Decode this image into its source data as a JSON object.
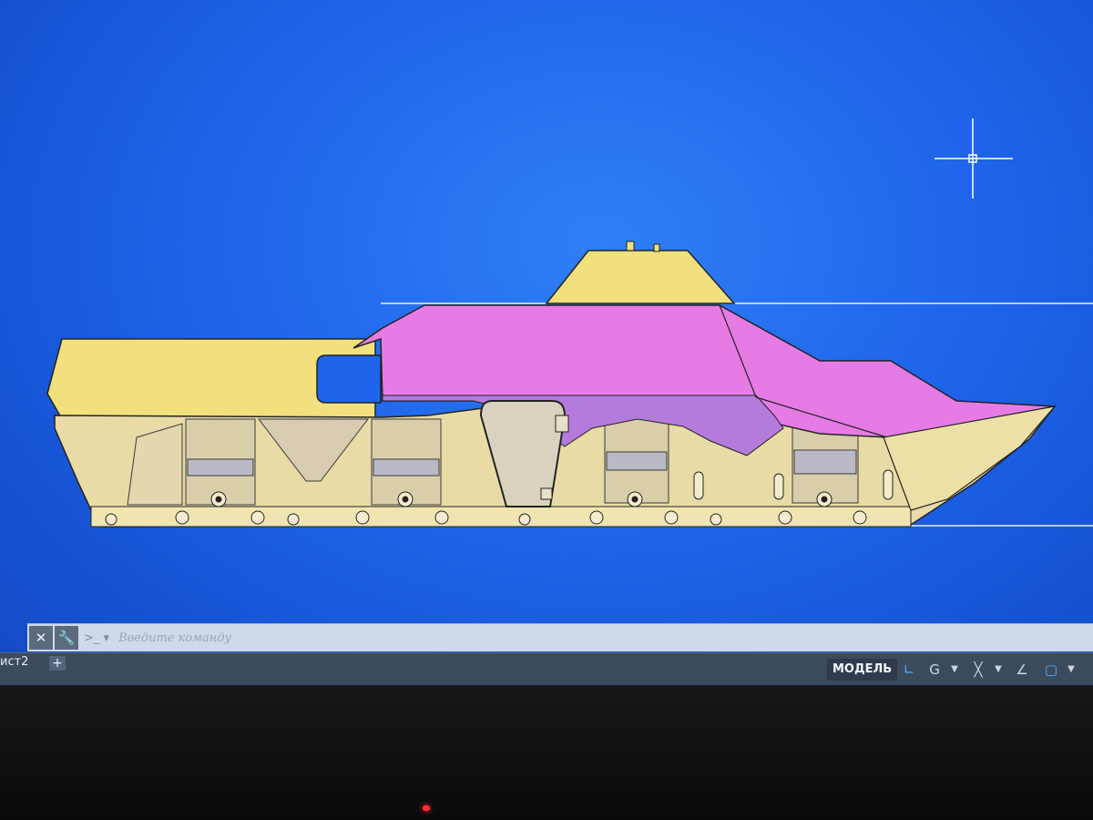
{
  "command_line": {
    "close_icon": "close-icon",
    "customize_icon": "wrench-icon",
    "prompt_icon": "command-prompt-icon",
    "input_placeholder": "Введите  команду"
  },
  "status_bar": {
    "layout_tab_label": "ист2",
    "add_layout_label": "+",
    "model_label": "МОДЕЛЬ",
    "tools": [
      "grid-icon",
      "polar-tracking-icon",
      "object-snap-icon",
      "isometric-draft-icon",
      "workspace-icon"
    ]
  },
  "colors": {
    "background": "#1f64ea",
    "hull": "#f2df7e",
    "upper_hull": "#e77be6",
    "outline": "#232323"
  }
}
